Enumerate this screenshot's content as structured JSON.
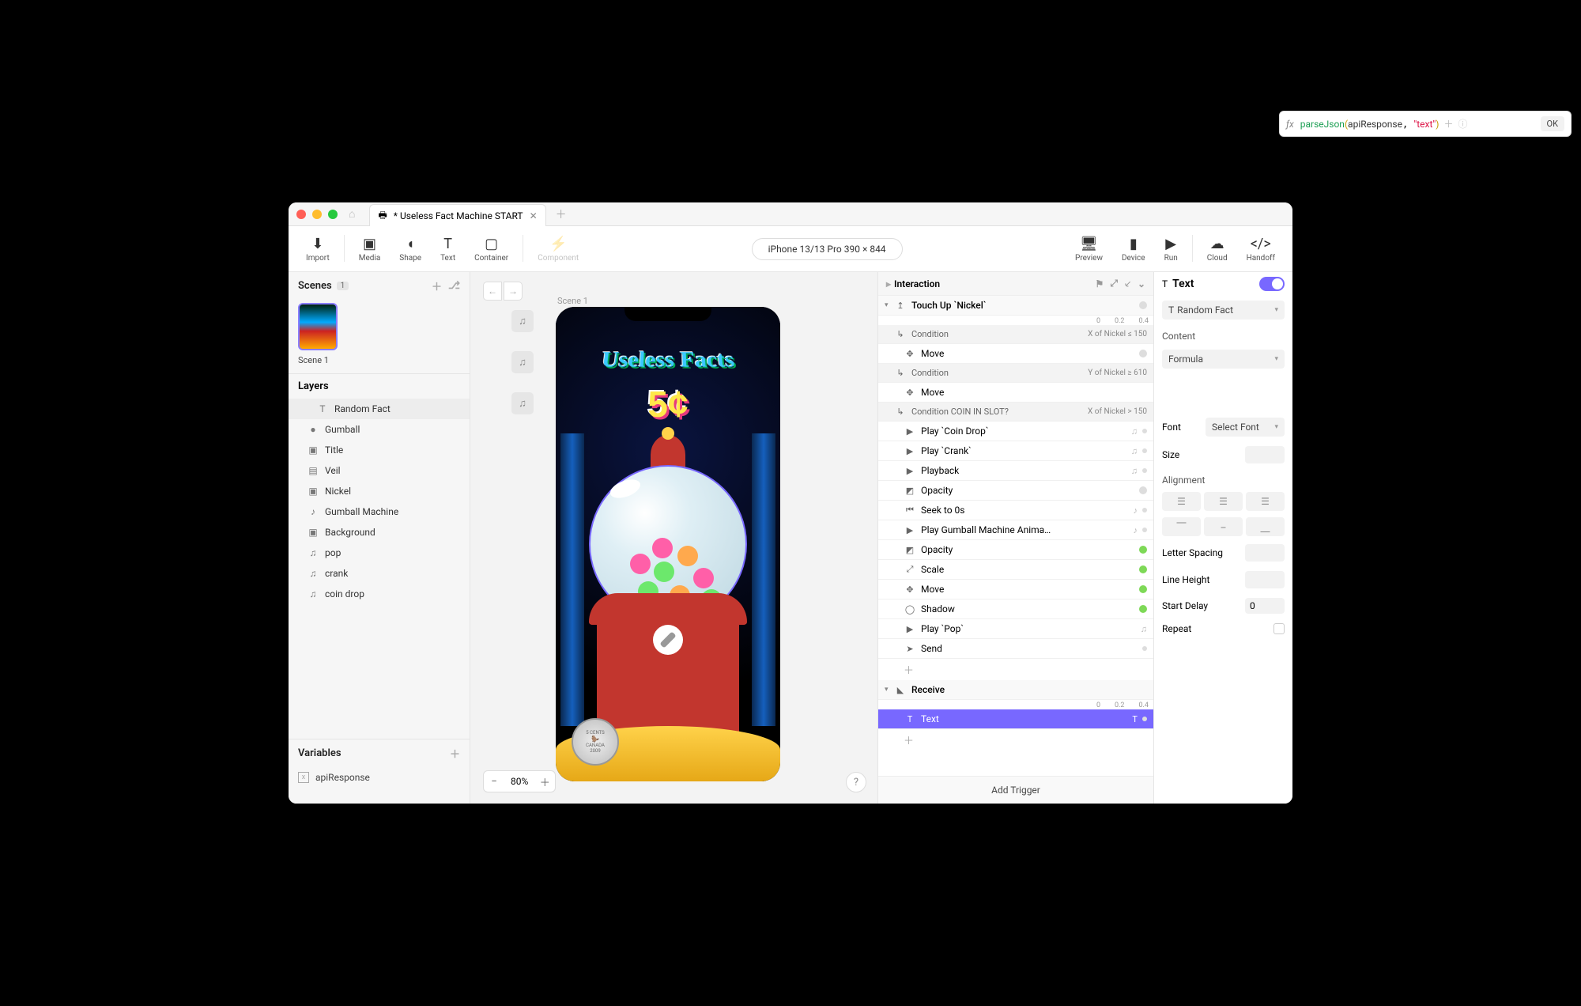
{
  "tab": {
    "title": "* Useless Fact Machine START"
  },
  "toolbar": {
    "import": "Import",
    "media": "Media",
    "shape": "Shape",
    "text": "Text",
    "container": "Container",
    "component": "Component",
    "preview": "Preview",
    "device": "Device",
    "run": "Run",
    "cloud": "Cloud",
    "handoff": "Handoff"
  },
  "devicePill": "iPhone 13/13 Pro  390 × 844",
  "scenes": {
    "header": "Scenes",
    "count": "1",
    "items": [
      {
        "label": "Scene 1"
      }
    ]
  },
  "layers": {
    "header": "Layers",
    "items": [
      {
        "icon": "T",
        "label": "Random Fact",
        "selected": true,
        "indent": true
      },
      {
        "icon": "●",
        "label": "Gumball"
      },
      {
        "icon": "▣",
        "label": "Title"
      },
      {
        "icon": "▤",
        "label": "Veil"
      },
      {
        "icon": "▣",
        "label": "Nickel"
      },
      {
        "icon": "♪",
        "label": "Gumball Machine"
      },
      {
        "icon": "▣",
        "label": "Background"
      },
      {
        "icon": "♫",
        "label": "pop"
      },
      {
        "icon": "♫",
        "label": "crank"
      },
      {
        "icon": "♫",
        "label": "coin drop"
      }
    ]
  },
  "variables": {
    "header": "Variables",
    "items": [
      {
        "label": "apiResponse"
      }
    ]
  },
  "canvas": {
    "sceneLabel": "Scene 1",
    "zoom": "80%",
    "titleText": "Useless Facts",
    "price": "5¢",
    "coin": {
      "top": "5 CENTS",
      "mid": "CANADA",
      "bot": "2009"
    }
  },
  "interaction": {
    "header": "Interaction",
    "timeline1": [
      "0",
      "0.2",
      "0.4"
    ],
    "triggers": [
      {
        "type": "head",
        "icon": "↥",
        "label": "Touch Up `Nickel`",
        "status": "grey"
      },
      {
        "type": "cond",
        "label": "Condition",
        "value": "X of Nickel ≤ 150"
      },
      {
        "type": "action",
        "icon": "✥",
        "label": "Move",
        "status": "grey"
      },
      {
        "type": "cond",
        "label": "Condition",
        "value": "Y of Nickel ≥ 610"
      },
      {
        "type": "action",
        "icon": "✥",
        "label": "Move"
      },
      {
        "type": "cond",
        "label": "Condition COIN IN SLOT?",
        "value": "X of Nickel > 150"
      },
      {
        "type": "action",
        "icon": "▶",
        "label": "Play `Coin Drop`",
        "right": "♫",
        "dot": true
      },
      {
        "type": "action",
        "icon": "▶",
        "label": "Play `Crank`",
        "right": "♫",
        "dot": true
      },
      {
        "type": "action",
        "icon": "▶",
        "label": "Playback",
        "right": "♫",
        "dot": true
      },
      {
        "type": "action",
        "icon": "◩",
        "label": "Opacity",
        "status": "grey"
      },
      {
        "type": "action",
        "icon": "⏮",
        "label": "Seek to 0s",
        "right": "♪",
        "dot": true
      },
      {
        "type": "action",
        "icon": "▶",
        "label": "Play Gumball Machine Anima…",
        "right": "♪",
        "dot": true
      },
      {
        "type": "action",
        "icon": "◩",
        "label": "Opacity",
        "status": "green"
      },
      {
        "type": "action",
        "icon": "⤢",
        "label": "Scale",
        "status": "green"
      },
      {
        "type": "action",
        "icon": "✥",
        "label": "Move",
        "status": "green"
      },
      {
        "type": "action",
        "icon": "◯",
        "label": "Shadow",
        "status": "green"
      },
      {
        "type": "action",
        "icon": "▶",
        "label": "Play `Pop`",
        "right": "♫"
      },
      {
        "type": "action",
        "icon": "➤",
        "label": "Send",
        "dot": true
      },
      {
        "type": "plus"
      },
      {
        "type": "head",
        "icon": "◣",
        "label": "Receive"
      },
      {
        "type": "selected",
        "icon": "T",
        "label": "Text",
        "right": "T",
        "dot": true
      },
      {
        "type": "plus"
      }
    ],
    "addTrigger": "Add Trigger"
  },
  "formula": {
    "fn": "parseJson",
    "arg": "apiResponse",
    "str": "\"text\"",
    "ok": "OK"
  },
  "inspector": {
    "title": "Text",
    "target": "Random Fact",
    "content": "Content",
    "contentMode": "Formula",
    "font": "Font",
    "fontValue": "Select Font",
    "size": "Size",
    "alignment": "Alignment",
    "letterSpacing": "Letter Spacing",
    "lineHeight": "Line Height",
    "startDelay": "Start Delay",
    "startDelayValue": "0",
    "repeat": "Repeat"
  }
}
